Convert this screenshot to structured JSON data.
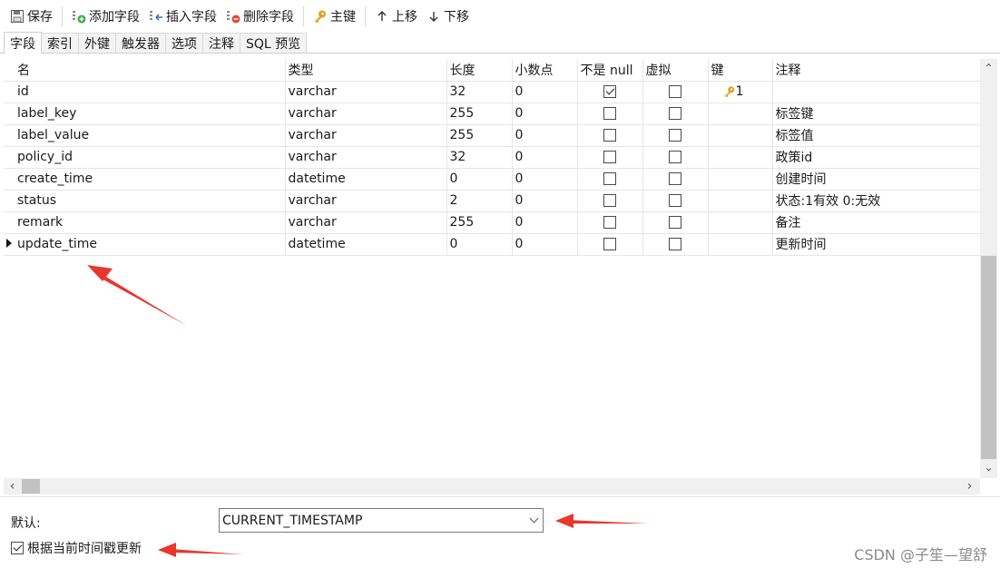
{
  "toolbar": {
    "save": "保存",
    "add_field": "添加字段",
    "insert_field": "插入字段",
    "delete_field": "删除字段",
    "primary_key": "主键",
    "move_up": "上移",
    "move_down": "下移"
  },
  "tabs": [
    {
      "label": "字段",
      "active": true
    },
    {
      "label": "索引"
    },
    {
      "label": "外键"
    },
    {
      "label": "触发器"
    },
    {
      "label": "选项"
    },
    {
      "label": "注释"
    },
    {
      "label": "SQL 预览"
    }
  ],
  "columns": {
    "name": "名",
    "type": "类型",
    "length": "长度",
    "decimals": "小数点",
    "not_null": "不是 null",
    "virtual": "虚拟",
    "key": "键",
    "comment": "注释"
  },
  "rows": [
    {
      "name": "id",
      "type": "varchar",
      "length": "32",
      "decimals": "0",
      "not_null": true,
      "virtual": false,
      "key": "1",
      "comment": ""
    },
    {
      "name": "label_key",
      "type": "varchar",
      "length": "255",
      "decimals": "0",
      "not_null": false,
      "virtual": false,
      "key": "",
      "comment": "标签键"
    },
    {
      "name": "label_value",
      "type": "varchar",
      "length": "255",
      "decimals": "0",
      "not_null": false,
      "virtual": false,
      "key": "",
      "comment": "标签值"
    },
    {
      "name": "policy_id",
      "type": "varchar",
      "length": "32",
      "decimals": "0",
      "not_null": false,
      "virtual": false,
      "key": "",
      "comment": "政策id"
    },
    {
      "name": "create_time",
      "type": "datetime",
      "length": "0",
      "decimals": "0",
      "not_null": false,
      "virtual": false,
      "key": "",
      "comment": "创建时间"
    },
    {
      "name": "status",
      "type": "varchar",
      "length": "2",
      "decimals": "0",
      "not_null": false,
      "virtual": false,
      "key": "",
      "comment": "状态:1有效 0:无效"
    },
    {
      "name": "remark",
      "type": "varchar",
      "length": "255",
      "decimals": "0",
      "not_null": false,
      "virtual": false,
      "key": "",
      "comment": "备注"
    },
    {
      "name": "update_time",
      "type": "datetime",
      "length": "0",
      "decimals": "0",
      "not_null": false,
      "virtual": false,
      "key": "",
      "comment": "更新时间",
      "current": true
    }
  ],
  "properties": {
    "default_label": "默认:",
    "default_value": "CURRENT_TIMESTAMP",
    "on_update_label": "根据当前时间戳更新",
    "on_update_checked": true
  },
  "watermark": "CSDN @子笙—望舒",
  "colors": {
    "accent_arrow": "#e8372c",
    "key_icon": "#e0a21a",
    "scroll_thumb": "#c2c2c2"
  }
}
